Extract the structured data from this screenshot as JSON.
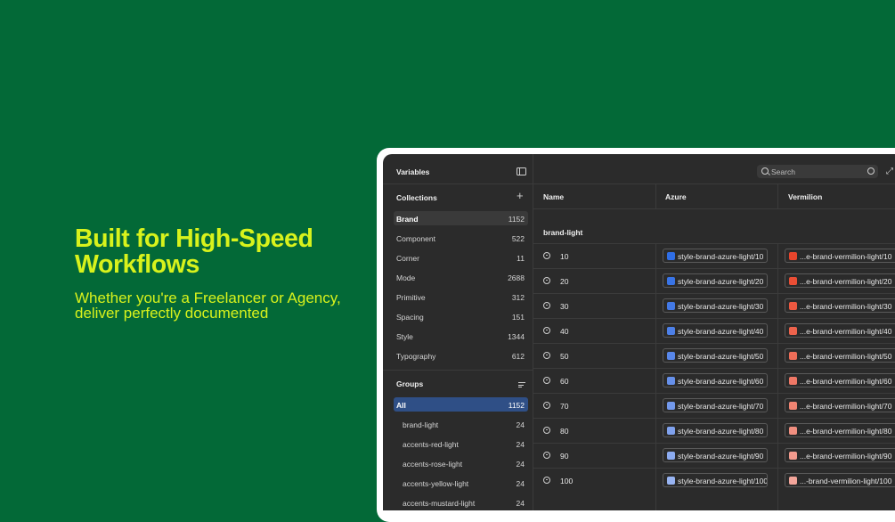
{
  "hero": {
    "title": "Built for High-Speed\nWorkflows",
    "subtitle": "Whether you're a Freelancer or Agency,\ndeliver perfectly documented"
  },
  "sidebar": {
    "title": "Variables",
    "collections_title": "Collections",
    "collections": [
      {
        "label": "Brand",
        "count": "1152",
        "selected": true
      },
      {
        "label": "Component",
        "count": "522"
      },
      {
        "label": "Corner",
        "count": "11"
      },
      {
        "label": "Mode",
        "count": "2688"
      },
      {
        "label": "Primitive",
        "count": "312"
      },
      {
        "label": "Spacing",
        "count": "151"
      },
      {
        "label": "Style",
        "count": "1344"
      },
      {
        "label": "Typography",
        "count": "612"
      }
    ],
    "groups_title": "Groups",
    "groups": [
      {
        "label": "All",
        "count": "1152",
        "selected": true
      },
      {
        "label": "brand-light",
        "count": "24"
      },
      {
        "label": "accents-red-light",
        "count": "24"
      },
      {
        "label": "accents-rose-light",
        "count": "24"
      },
      {
        "label": "accents-yellow-light",
        "count": "24"
      },
      {
        "label": "accents-mustard-light",
        "count": "24"
      }
    ]
  },
  "search": {
    "placeholder": "Search"
  },
  "table": {
    "columns": [
      "Name",
      "Azure",
      "Vermilion"
    ],
    "group_label": "brand-light",
    "rows": [
      {
        "name": "10",
        "azure": "style-brand-azure-light/10",
        "vermilion": "...e-brand-vermilion-light/10"
      },
      {
        "name": "20",
        "azure": "style-brand-azure-light/20",
        "vermilion": "...e-brand-vermilion-light/20"
      },
      {
        "name": "30",
        "azure": "style-brand-azure-light/30",
        "vermilion": "...e-brand-vermilion-light/30"
      },
      {
        "name": "40",
        "azure": "style-brand-azure-light/40",
        "vermilion": "...e-brand-vermilion-light/40"
      },
      {
        "name": "50",
        "azure": "style-brand-azure-light/50",
        "vermilion": "...e-brand-vermilion-light/50"
      },
      {
        "name": "60",
        "azure": "style-brand-azure-light/60",
        "vermilion": "...e-brand-vermilion-light/60"
      },
      {
        "name": "70",
        "azure": "style-brand-azure-light/70",
        "vermilion": "...e-brand-vermilion-light/70"
      },
      {
        "name": "80",
        "azure": "style-brand-azure-light/80",
        "vermilion": "...e-brand-vermilion-light/80"
      },
      {
        "name": "90",
        "azure": "style-brand-azure-light/90",
        "vermilion": "...e-brand-vermilion-light/90"
      },
      {
        "name": "100",
        "azure": "style-brand-azure-light/100",
        "vermilion": "...-brand-vermilion-light/100"
      }
    ]
  },
  "colors": {
    "background": "#036937",
    "accent_text": "#d8f21c",
    "azure_swatches": [
      "#2f6ee6",
      "#3974e6",
      "#4379e6",
      "#4d80e8",
      "#5887ea",
      "#6690ea",
      "#7399ec",
      "#80a2ee",
      "#8cabf0",
      "#98b4f2"
    ],
    "vermilion_swatches": [
      "#e8452c",
      "#ea4e35",
      "#ec5840",
      "#ee634c",
      "#ee6d58",
      "#ef7866",
      "#f08472",
      "#f18f80",
      "#f29a8d",
      "#f3a59a"
    ]
  }
}
